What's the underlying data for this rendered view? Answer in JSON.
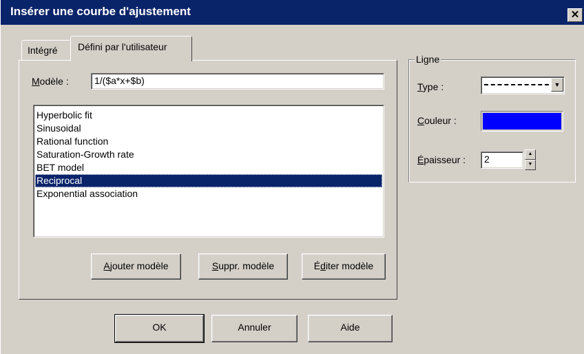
{
  "window": {
    "title": "Insérer une courbe d'ajustement",
    "close_glyph": "✕"
  },
  "tabs": [
    {
      "label": "Intégré",
      "selected": false
    },
    {
      "label": "Défini par l'utilisateur",
      "selected": true
    }
  ],
  "model": {
    "label": "Modèle :",
    "value": "1/($a*x+$b)"
  },
  "list": {
    "items": [
      "Hyperbolic fit",
      "Sinusoidal",
      "Rational function",
      "Saturation-Growth rate",
      "BET model",
      "Reciprocal",
      "Exponential association"
    ],
    "selected_index": 5
  },
  "buttons": {
    "add": "Ajouter modèle",
    "delete": "Suppr. modèle",
    "edit": "Éditer modèle",
    "ok": "OK",
    "cancel": "Annuler",
    "help": "Aide"
  },
  "line_group": {
    "title": "Ligne",
    "type_label": "Type :",
    "type_value_icon": "dashed-line-icon",
    "color_label": "Couleur :",
    "color_value": "#0000ff",
    "thickness_label": "Épaisseur :",
    "thickness_value": "2"
  },
  "colors": {
    "face": "#d4d0c8",
    "titlebar": "#0a246a",
    "selection": "#0a246a"
  }
}
